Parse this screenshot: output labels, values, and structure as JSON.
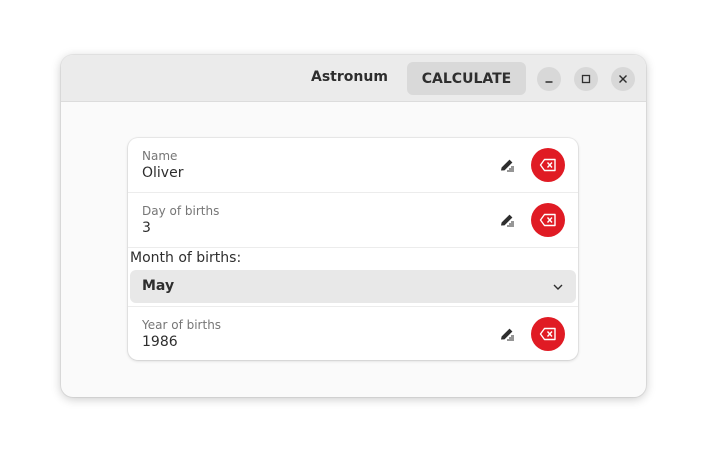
{
  "window": {
    "title": "Astronum",
    "calculate_label": "CALCULATE",
    "controls": [
      "minimize-icon",
      "maximize-icon",
      "close-icon"
    ]
  },
  "form": {
    "name": {
      "label": "Name",
      "value": "Oliver"
    },
    "day": {
      "label": "Day of births",
      "value": "3"
    },
    "month": {
      "label": "Month of births:",
      "selected": "May"
    },
    "year": {
      "label": "Year of births",
      "value": "1986"
    }
  },
  "icons": {
    "edit": "pencil-edit-icon",
    "clear": "backspace-clear-icon",
    "dropdown": "chevron-down-icon"
  },
  "colors": {
    "accent_destructive": "#e01b24",
    "headerbar": "#ebebeb",
    "window_bg": "#fafafa"
  }
}
